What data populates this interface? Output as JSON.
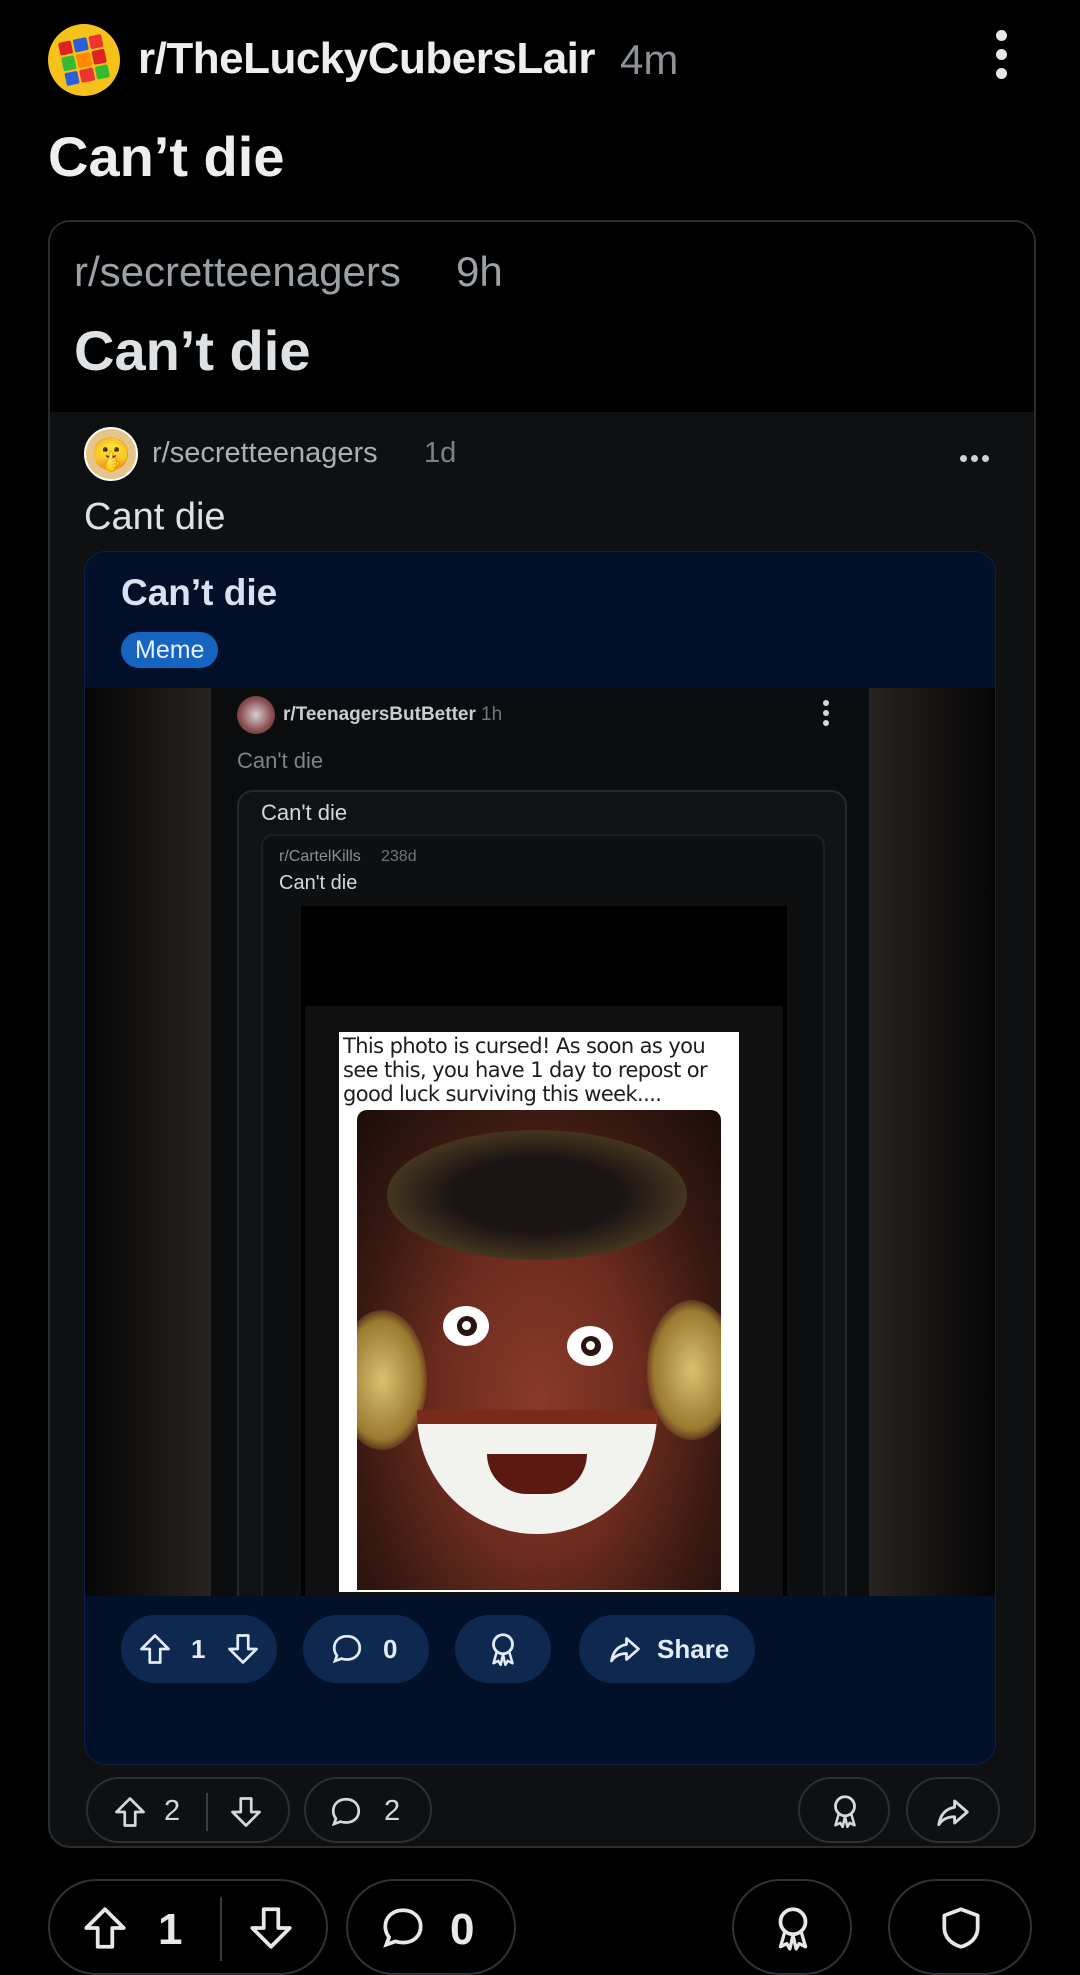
{
  "post": {
    "subreddit": "r/TheLuckyCubersLair",
    "time": "4m",
    "title": "Can’t die"
  },
  "crosspost": {
    "subreddit": "r/secretteenagers",
    "time": "9h",
    "title": "Can’t die",
    "inner": {
      "subreddit": "r/secretteenagers",
      "time": "1d",
      "title": "Cant die",
      "card": {
        "title": "Can’t die",
        "flair": "Meme",
        "screenshot": {
          "subreddit": "r/TeenagersButBetter",
          "time": "1h",
          "title": "Can't die",
          "card_title": "Can't die",
          "nested_subreddit": "r/CartelKills",
          "nested_time": "238d",
          "nested_title": "Can't die",
          "cursed_text": "This photo is cursed! As soon as you see this, you have 1 day to repost or good luck surviving this week...."
        },
        "actions": {
          "votes": "1",
          "comments": "0",
          "share_label": "Share"
        }
      }
    },
    "actions": {
      "votes": "2",
      "comments": "2"
    }
  },
  "bottom_bar": {
    "votes": "1",
    "comments": "0"
  },
  "colors": {
    "background": "#000000",
    "card_navy": "#031029",
    "flair_blue": "#1564c0",
    "pill_navy": "#0f2850"
  },
  "icons": [
    "rubiks-cube-avatar",
    "kebab-menu-icon",
    "shush-emoji-avatar",
    "upvote-icon",
    "downvote-icon",
    "comment-icon",
    "award-icon",
    "share-icon",
    "shield-icon"
  ]
}
